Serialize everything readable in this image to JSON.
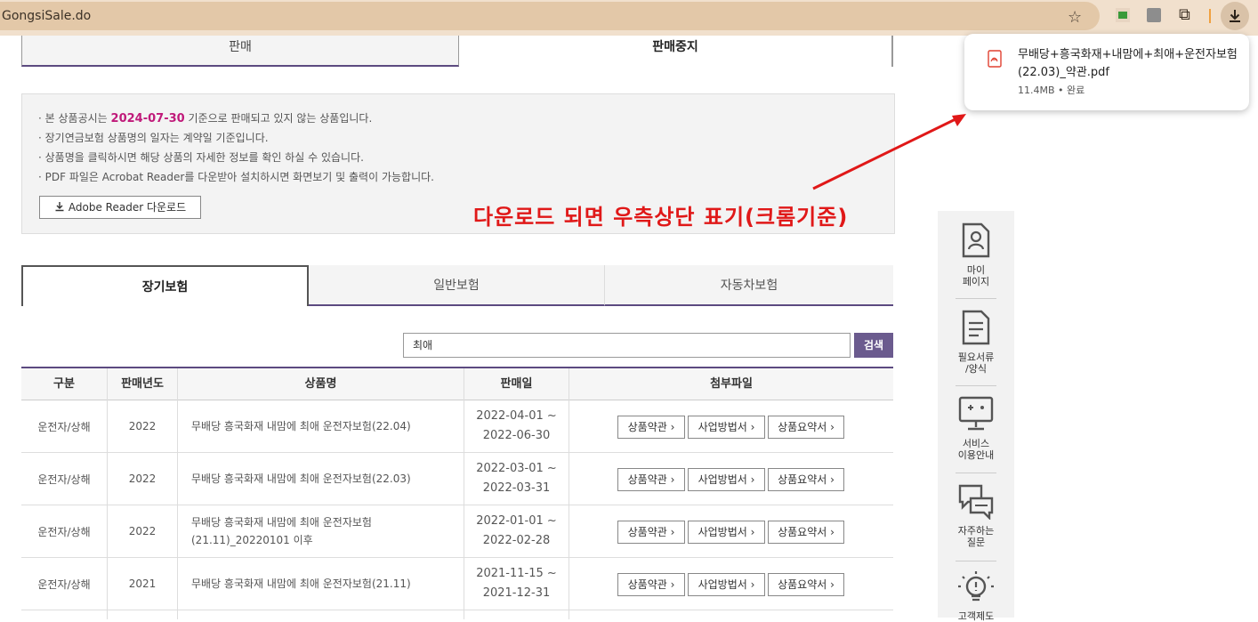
{
  "browser": {
    "url": "GongsiSale.do",
    "download_popup": {
      "filename": "무배당+흥국화재+내맘에+최애+운전자보험(22.03)_약관.pdf",
      "size": "11.4MB",
      "status": "완료"
    }
  },
  "top_tabs": [
    "판매",
    "판매중지"
  ],
  "notice": {
    "line1_prefix": "본 상품공시는",
    "line1_date": "2024-07-30",
    "line1_suffix": "기준으로 판매되고 있지 않는 상품입니다.",
    "line2": "장기연금보험 상품명의 일자는 계약일 기준입니다.",
    "line3": "상품명을 클릭하시면 해당 상품의 자세한 정보를 확인 하실 수 있습니다.",
    "line4": "PDF 파일은 Acrobat Reader를 다운받아 설치하시면 화면보기 및 출력이 가능합니다.",
    "adobe_button": "Adobe Reader 다운로드"
  },
  "annotation": "다운로드 되면 우측상단 표기(크롬기준)",
  "category_tabs": [
    "장기보험",
    "일반보험",
    "자동차보험"
  ],
  "search": {
    "value": "최애",
    "button": "검색"
  },
  "table": {
    "headers": [
      "구분",
      "판매년도",
      "상품명",
      "판매일",
      "첨부파일"
    ],
    "rows": [
      {
        "category": "운전자/상해",
        "year": "2022",
        "product": "무배당 흥국화재 내맘에 최애 운전자보험(22.04)",
        "date_from": "2022-04-01 ~",
        "date_to": "2022-06-30"
      },
      {
        "category": "운전자/상해",
        "year": "2022",
        "product": "무배당 흥국화재 내맘에 최애 운전자보험(22.03)",
        "date_from": "2022-03-01 ~",
        "date_to": "2022-03-31"
      },
      {
        "category": "운전자/상해",
        "year": "2022",
        "product": "무배당 흥국화재 내맘에 최애 운전자보험(21.11)_20220101 이후",
        "date_from": "2022-01-01 ~",
        "date_to": "2022-02-28"
      },
      {
        "category": "운전자/상해",
        "year": "2021",
        "product": "무배당 흥국화재 내맘에 최애 운전자보험(21.11)",
        "date_from": "2021-11-15 ~",
        "date_to": "2021-12-31"
      }
    ],
    "attach_buttons": [
      "상품약관 ›",
      "사업방법서 ›",
      "상품요약서 ›"
    ]
  },
  "sidebar": {
    "mypage_1": "마이",
    "mypage_2": "페이지",
    "docs_1": "필요서류",
    "docs_2": "/양식",
    "service_1": "서비스",
    "service_2": "이용안내",
    "faq_1": "자주하는",
    "faq_2": "질문",
    "last": "고객제도"
  },
  "colors": {
    "accent": "#5c4a80",
    "highlight": "#c01a7a",
    "annotation": "#e01818"
  }
}
